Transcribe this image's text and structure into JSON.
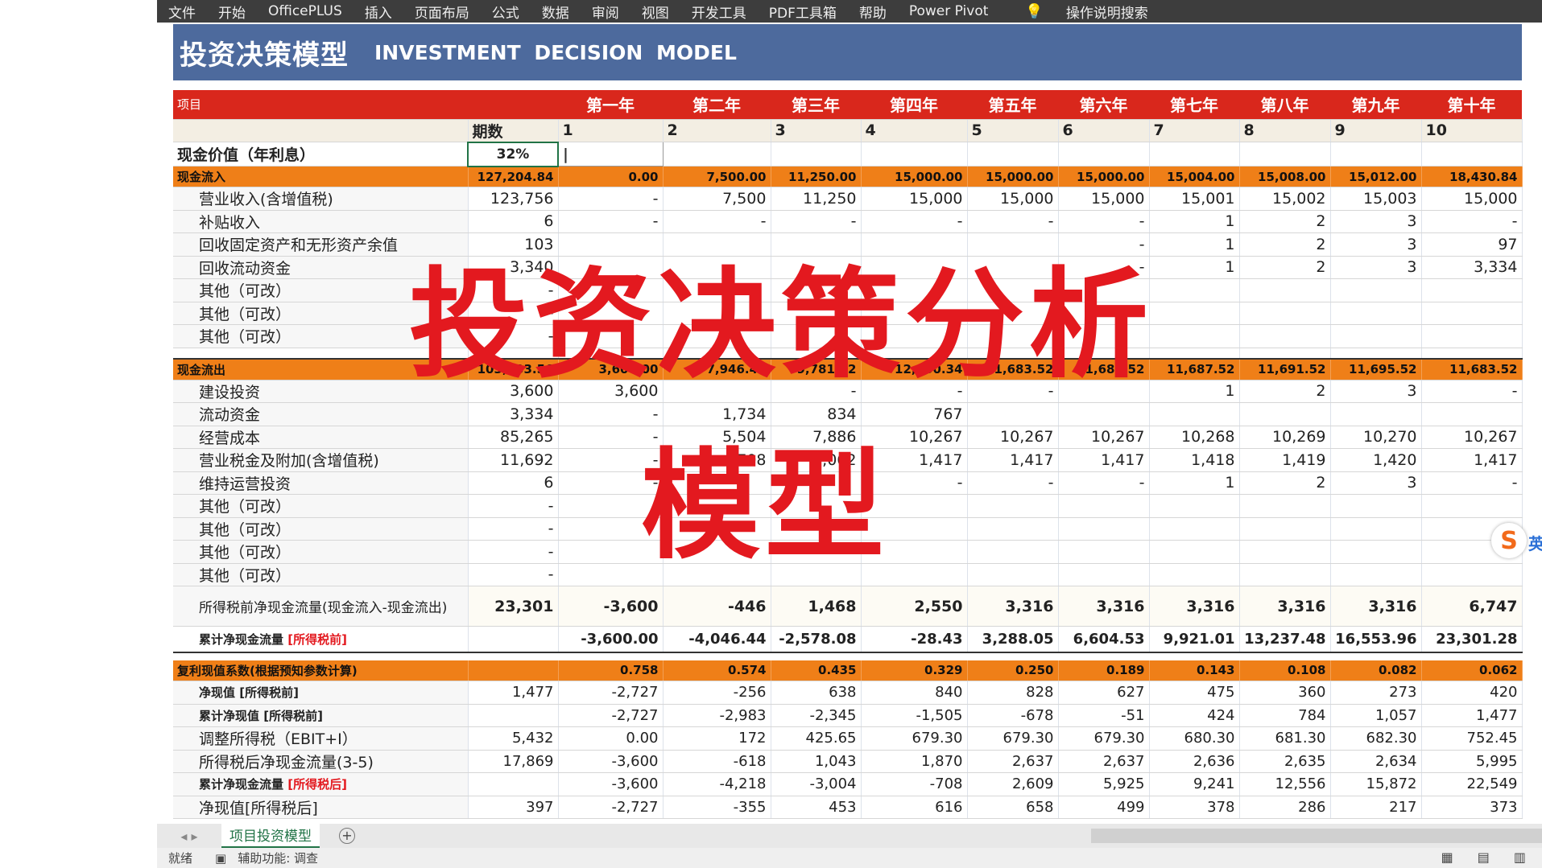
{
  "ribbon": {
    "tabs": [
      "文件",
      "开始",
      "OfficePLUS",
      "插入",
      "页面布局",
      "公式",
      "数据",
      "审阅",
      "视图",
      "开发工具",
      "PDF工具箱",
      "帮助",
      "Power Pivot"
    ],
    "search": "操作说明搜索",
    "search_icon": "lightbulb-icon"
  },
  "banner": {
    "zh": "投资决策模型",
    "en": "INVESTMENT DECISION MODEL"
  },
  "header": {
    "label": "项目",
    "years": [
      "第一年",
      "第二年",
      "第三年",
      "第四年",
      "第五年",
      "第六年",
      "第七年",
      "第八年",
      "第九年",
      "第十年"
    ]
  },
  "period_row": {
    "label": "期数",
    "values": [
      "1",
      "2",
      "3",
      "4",
      "5",
      "6",
      "7",
      "8",
      "9",
      "10"
    ]
  },
  "pv_row": {
    "label": "现金价值（年利息）",
    "rate": "32%",
    "cursor": "|"
  },
  "inflow": {
    "label": "现金流入",
    "values": [
      "127,204.84",
      "0.00",
      "7,500.00",
      "11,250.00",
      "15,000.00",
      "15,000.00",
      "15,000.00",
      "15,004.00",
      "15,008.00",
      "15,012.00",
      "18,430.84"
    ],
    "items": [
      {
        "label": "营业收入(含增值税)",
        "values": [
          "123,756",
          "-",
          "7,500",
          "11,250",
          "15,000",
          "15,000",
          "15,000",
          "15,001",
          "15,002",
          "15,003",
          "15,000"
        ]
      },
      {
        "label": "补贴收入",
        "values": [
          "6",
          "-",
          "-",
          "-",
          "-",
          "-",
          "-",
          "1",
          "2",
          "3",
          "-"
        ]
      },
      {
        "label": "回收固定资产和无形资产余值",
        "values": [
          "103",
          "",
          "",
          "",
          "",
          "",
          "-",
          "1",
          "2",
          "3",
          "97"
        ]
      },
      {
        "label": "回收流动资金",
        "values": [
          "3,340",
          "",
          "",
          "",
          "",
          "",
          "-",
          "1",
          "2",
          "3",
          "3,334"
        ]
      },
      {
        "label": "其他（可改）",
        "values": [
          "-",
          "",
          "",
          "",
          "",
          "",
          "",
          "",
          "",
          "",
          ""
        ]
      },
      {
        "label": "其他（可改）",
        "values": [
          "-",
          "",
          "",
          "",
          "",
          "",
          "",
          "",
          "",
          "",
          ""
        ]
      },
      {
        "label": "其他（可改）",
        "values": [
          "-",
          "",
          "",
          "",
          "",
          "",
          "",
          "",
          "",
          "",
          ""
        ]
      }
    ]
  },
  "outflow": {
    "label": "现金流出",
    "values": [
      "103,903.56",
      "3,600.00",
      "7,946.44",
      "9,781.92",
      "12,450.34",
      "11,683.52",
      "11,683.52",
      "11,687.52",
      "11,691.52",
      "11,695.52",
      "11,683.52"
    ],
    "items": [
      {
        "label": "建设投资",
        "values": [
          "3,600",
          "3,600",
          "",
          "-",
          "-",
          "-",
          "",
          "1",
          "2",
          "3",
          "-"
        ]
      },
      {
        "label": "流动资金",
        "values": [
          "3,334",
          "-",
          "1,734",
          "834",
          "767",
          "",
          "",
          "",
          "",
          "",
          ""
        ]
      },
      {
        "label": "经营成本",
        "values": [
          "85,265",
          "-",
          "5,504",
          "7,886",
          "10,267",
          "10,267",
          "10,267",
          "10,268",
          "10,269",
          "10,270",
          "10,267"
        ]
      },
      {
        "label": "营业税金及附加(含增值税)",
        "values": [
          "11,692",
          "-",
          "708",
          "1,062",
          "1,417",
          "1,417",
          "1,417",
          "1,418",
          "1,419",
          "1,420",
          "1,417"
        ]
      },
      {
        "label": "维持运营投资",
        "values": [
          "6",
          "-",
          "",
          "",
          "-",
          "-",
          "-",
          "1",
          "2",
          "3",
          "-"
        ]
      },
      {
        "label": "其他（可改）",
        "values": [
          "-",
          "",
          "",
          "",
          "",
          "",
          "",
          "",
          "",
          "",
          ""
        ]
      },
      {
        "label": "其他（可改）",
        "values": [
          "-",
          "",
          "",
          "",
          "",
          "",
          "",
          "",
          "",
          "",
          ""
        ]
      },
      {
        "label": "其他（可改）",
        "values": [
          "-",
          "",
          "",
          "",
          "",
          "",
          "",
          "",
          "",
          "",
          ""
        ]
      },
      {
        "label": "其他（可改）",
        "values": [
          "-",
          "",
          "",
          "",
          "",
          "",
          "",
          "",
          "",
          "",
          ""
        ]
      }
    ]
  },
  "pretax_ncf": {
    "label": "所得税前净现金流量(现金流入-现金流出)",
    "values": [
      "23,301",
      "-3,600",
      "-446",
      "1,468",
      "2,550",
      "3,316",
      "3,316",
      "3,316",
      "3,316",
      "3,316",
      "6,747"
    ]
  },
  "cum_pretax": {
    "label": "累计净现金流量",
    "tag": "[所得税前]",
    "values": [
      "",
      "-3,600.00",
      "-4,046.44",
      "-2,578.08",
      "-28.43",
      "3,288.05",
      "6,604.53",
      "9,921.01",
      "13,237.48",
      "16,553.96",
      "23,301.28"
    ]
  },
  "discount": {
    "label": "复利现值系数(根据预知参数计算)",
    "values": [
      "",
      "0.758",
      "0.574",
      "0.435",
      "0.329",
      "0.250",
      "0.189",
      "0.143",
      "0.108",
      "0.082",
      "0.062"
    ]
  },
  "rows_bottom": [
    {
      "label": "净现值 [所得税前]",
      "bold": true,
      "values": [
        "1,477",
        "-2,727",
        "-256",
        "638",
        "840",
        "828",
        "627",
        "475",
        "360",
        "273",
        "420"
      ]
    },
    {
      "label": "累计净现值 [所得税前]",
      "bold": true,
      "values": [
        "",
        "-2,727",
        "-2,983",
        "-2,345",
        "-1,505",
        "-678",
        "-51",
        "424",
        "784",
        "1,057",
        "1,477"
      ]
    },
    {
      "label": "调整所得税（EBIT+I）",
      "bold": false,
      "values": [
        "5,432",
        "0.00",
        "172",
        "425.65",
        "679.30",
        "679.30",
        "679.30",
        "680.30",
        "681.30",
        "682.30",
        "752.45"
      ]
    },
    {
      "label": "所得税后净现金流量(3-5)",
      "bold": false,
      "values": [
        "17,869",
        "-3,600",
        "-618",
        "1,043",
        "1,870",
        "2,637",
        "2,637",
        "2,636",
        "2,635",
        "2,634",
        "5,995"
      ]
    },
    {
      "label": "累计净现金流量",
      "tag": "[所得税后]",
      "bold": true,
      "values": [
        "",
        "-3,600",
        "-4,218",
        "-3,004",
        "-708",
        "2,609",
        "5,925",
        "9,241",
        "12,556",
        "15,872",
        "22,549"
      ]
    },
    {
      "label": "净现值[所得税后]",
      "bold": false,
      "values": [
        "397",
        "-2,727",
        "-355",
        "453",
        "616",
        "658",
        "499",
        "378",
        "286",
        "217",
        "373"
      ]
    }
  ],
  "overlay": {
    "line1": "投资决策分析",
    "line2": "模型"
  },
  "sheet_tab": "项目投资模型",
  "status": {
    "ready": "就绪",
    "accessibility": "辅助功能: 调查"
  },
  "ime": {
    "label": "英"
  }
}
